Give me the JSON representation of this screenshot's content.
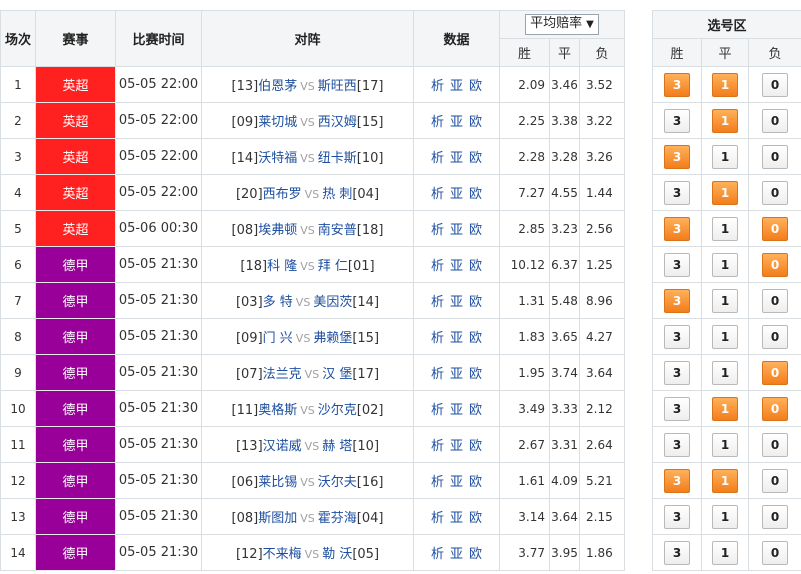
{
  "header": {
    "col_no": "场次",
    "col_league": "赛事",
    "col_time": "比赛时间",
    "col_match": "对阵",
    "col_data": "数据",
    "odds_select": "平均赔率",
    "odds_win": "胜",
    "odds_draw": "平",
    "odds_lose": "负",
    "pick_area": "选号区",
    "pick_win": "胜",
    "pick_draw": "平",
    "pick_lose": "负"
  },
  "data_links": [
    "析",
    "亚",
    "欧"
  ],
  "vs_text": "VS",
  "colors": {
    "premier_league": "#ff2020",
    "bundesliga": "#990099",
    "pick_selected": "#f37d1b",
    "team_link": "#1e4fa0"
  },
  "matches": [
    {
      "no": "1",
      "league": "英超",
      "league_color": "#ff2020",
      "time": "05-05 22:00",
      "home_rank": "[13]",
      "home": "伯恩茅",
      "away": "斯旺西",
      "away_rank": "[17]",
      "win": "2.09",
      "draw": "3.46",
      "lose": "3.52",
      "pick_win": "3",
      "pick_draw": "1",
      "pick_lose": "0",
      "sel_win": true,
      "sel_draw": true,
      "sel_lose": false
    },
    {
      "no": "2",
      "league": "英超",
      "league_color": "#ff2020",
      "time": "05-05 22:00",
      "home_rank": "[09]",
      "home": "莱切城",
      "away": "西汉姆",
      "away_rank": "[15]",
      "win": "2.25",
      "draw": "3.38",
      "lose": "3.22",
      "pick_win": "3",
      "pick_draw": "1",
      "pick_lose": "0",
      "sel_win": false,
      "sel_draw": true,
      "sel_lose": false
    },
    {
      "no": "3",
      "league": "英超",
      "league_color": "#ff2020",
      "time": "05-05 22:00",
      "home_rank": "[14]",
      "home": "沃特福",
      "away": "纽卡斯",
      "away_rank": "[10]",
      "win": "2.28",
      "draw": "3.28",
      "lose": "3.26",
      "pick_win": "3",
      "pick_draw": "1",
      "pick_lose": "0",
      "sel_win": true,
      "sel_draw": false,
      "sel_lose": false
    },
    {
      "no": "4",
      "league": "英超",
      "league_color": "#ff2020",
      "time": "05-05 22:00",
      "home_rank": "[20]",
      "home": "西布罗",
      "away": "热 刺",
      "away_rank": "[04]",
      "win": "7.27",
      "draw": "4.55",
      "lose": "1.44",
      "pick_win": "3",
      "pick_draw": "1",
      "pick_lose": "0",
      "sel_win": false,
      "sel_draw": true,
      "sel_lose": false
    },
    {
      "no": "5",
      "league": "英超",
      "league_color": "#ff2020",
      "time": "05-06 00:30",
      "home_rank": "[08]",
      "home": "埃弗顿",
      "away": "南安普",
      "away_rank": "[18]",
      "win": "2.85",
      "draw": "3.23",
      "lose": "2.56",
      "pick_win": "3",
      "pick_draw": "1",
      "pick_lose": "0",
      "sel_win": true,
      "sel_draw": false,
      "sel_lose": true
    },
    {
      "no": "6",
      "league": "德甲",
      "league_color": "#990099",
      "time": "05-05 21:30",
      "home_rank": "[18]",
      "home": "科 隆",
      "away": "拜 仁",
      "away_rank": "[01]",
      "win": "10.12",
      "draw": "6.37",
      "lose": "1.25",
      "pick_win": "3",
      "pick_draw": "1",
      "pick_lose": "0",
      "sel_win": false,
      "sel_draw": false,
      "sel_lose": true
    },
    {
      "no": "7",
      "league": "德甲",
      "league_color": "#990099",
      "time": "05-05 21:30",
      "home_rank": "[03]",
      "home": "多 特",
      "away": "美因茨",
      "away_rank": "[14]",
      "win": "1.31",
      "draw": "5.48",
      "lose": "8.96",
      "pick_win": "3",
      "pick_draw": "1",
      "pick_lose": "0",
      "sel_win": true,
      "sel_draw": false,
      "sel_lose": false
    },
    {
      "no": "8",
      "league": "德甲",
      "league_color": "#990099",
      "time": "05-05 21:30",
      "home_rank": "[09]",
      "home": "门 兴",
      "away": "弗赖堡",
      "away_rank": "[15]",
      "win": "1.83",
      "draw": "3.65",
      "lose": "4.27",
      "pick_win": "3",
      "pick_draw": "1",
      "pick_lose": "0",
      "sel_win": false,
      "sel_draw": false,
      "sel_lose": false
    },
    {
      "no": "9",
      "league": "德甲",
      "league_color": "#990099",
      "time": "05-05 21:30",
      "home_rank": "[07]",
      "home": "法兰克",
      "away": "汉 堡",
      "away_rank": "[17]",
      "win": "1.95",
      "draw": "3.74",
      "lose": "3.64",
      "pick_win": "3",
      "pick_draw": "1",
      "pick_lose": "0",
      "sel_win": false,
      "sel_draw": false,
      "sel_lose": true
    },
    {
      "no": "10",
      "league": "德甲",
      "league_color": "#990099",
      "time": "05-05 21:30",
      "home_rank": "[11]",
      "home": "奥格斯",
      "away": "沙尔克",
      "away_rank": "[02]",
      "win": "3.49",
      "draw": "3.33",
      "lose": "2.12",
      "pick_win": "3",
      "pick_draw": "1",
      "pick_lose": "0",
      "sel_win": false,
      "sel_draw": true,
      "sel_lose": true
    },
    {
      "no": "11",
      "league": "德甲",
      "league_color": "#990099",
      "time": "05-05 21:30",
      "home_rank": "[13]",
      "home": "汉诺威",
      "away": "赫 塔",
      "away_rank": "[10]",
      "win": "2.67",
      "draw": "3.31",
      "lose": "2.64",
      "pick_win": "3",
      "pick_draw": "1",
      "pick_lose": "0",
      "sel_win": false,
      "sel_draw": false,
      "sel_lose": false
    },
    {
      "no": "12",
      "league": "德甲",
      "league_color": "#990099",
      "time": "05-05 21:30",
      "home_rank": "[06]",
      "home": "莱比锡",
      "away": "沃尔夫",
      "away_rank": "[16]",
      "win": "1.61",
      "draw": "4.09",
      "lose": "5.21",
      "pick_win": "3",
      "pick_draw": "1",
      "pick_lose": "0",
      "sel_win": true,
      "sel_draw": true,
      "sel_lose": false
    },
    {
      "no": "13",
      "league": "德甲",
      "league_color": "#990099",
      "time": "05-05 21:30",
      "home_rank": "[08]",
      "home": "斯图加",
      "away": "霍芬海",
      "away_rank": "[04]",
      "win": "3.14",
      "draw": "3.64",
      "lose": "2.15",
      "pick_win": "3",
      "pick_draw": "1",
      "pick_lose": "0",
      "sel_win": false,
      "sel_draw": false,
      "sel_lose": false
    },
    {
      "no": "14",
      "league": "德甲",
      "league_color": "#990099",
      "time": "05-05 21:30",
      "home_rank": "[12]",
      "home": "不来梅",
      "away": "勒 沃",
      "away_rank": "[05]",
      "win": "3.77",
      "draw": "3.95",
      "lose": "1.86",
      "pick_win": "3",
      "pick_draw": "1",
      "pick_lose": "0",
      "sel_win": false,
      "sel_draw": false,
      "sel_lose": false
    }
  ]
}
